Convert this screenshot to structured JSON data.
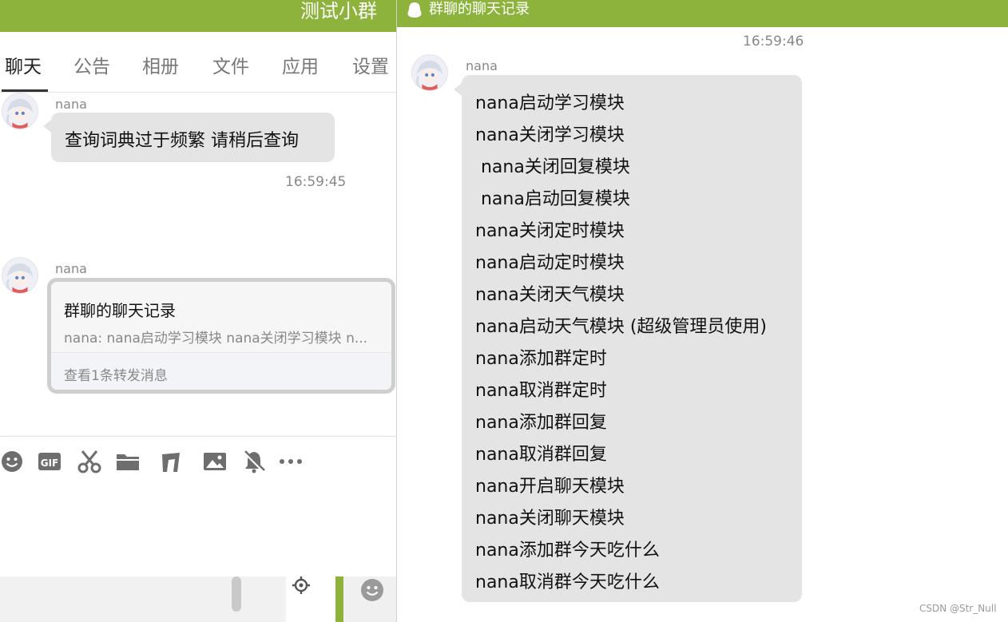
{
  "main_window": {
    "title": "测试小群",
    "tabs": [
      {
        "label": "聊天",
        "active": true
      },
      {
        "label": "公告",
        "active": false
      },
      {
        "label": "相册",
        "active": false
      },
      {
        "label": "文件",
        "active": false
      },
      {
        "label": "应用",
        "active": false
      },
      {
        "label": "设置",
        "active": false
      }
    ],
    "messages": [
      {
        "sender": "nana",
        "text": "查询词典过于频繁 请稍后查询"
      },
      {
        "time": "16:59:45"
      },
      {
        "sender": "nana",
        "forward_card": {
          "title": "群聊的聊天记录",
          "preview": "nana: nana启动学习模块 nana关闭学习模块 n...",
          "footer": "查看1条转发消息"
        }
      }
    ],
    "toolbar_icons": [
      "emoji-icon",
      "gif-icon",
      "scissors-icon",
      "folder-icon",
      "music-icon",
      "image-icon",
      "mute-bell-icon",
      "more-icon"
    ]
  },
  "record_window": {
    "title": "群聊的聊天记录",
    "time": "16:59:46",
    "sender": "nana",
    "lines": [
      "nana启动学习模块",
      "nana关闭学习模块",
      " nana关闭回复模块",
      " nana启动回复模块",
      "nana关闭定时模块",
      "nana启动定时模块",
      "nana关闭天气模块",
      "nana启动天气模块 (超级管理员使用)",
      "nana添加群定时",
      "nana取消群定时",
      "nana添加群回复",
      "nana取消群回复",
      "nana开启聊天模块",
      "nana关闭聊天模块",
      "nana添加群今天吃什么",
      "nana取消群今天吃什么"
    ]
  },
  "watermark": "CSDN @Str_Null",
  "colors": {
    "titlebar_green": "#8db33c",
    "bubble_grey": "#e4e4e4",
    "icon_grey": "#6e6e6e"
  }
}
